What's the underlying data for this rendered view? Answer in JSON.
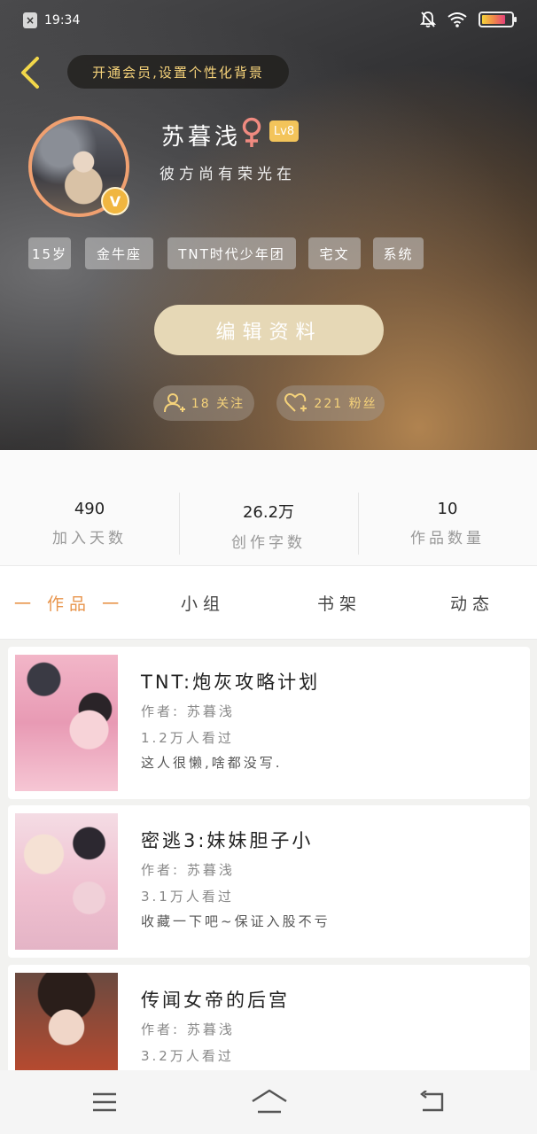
{
  "status_bar": {
    "time": "19:34",
    "battery_level": 0.8
  },
  "header": {
    "vip_prompt": "开通会员,设置个性化背景",
    "username": "苏暮浅",
    "level": "Lv8",
    "signature": "彼方尚有荣光在",
    "verified_badge": "V",
    "tags": [
      "15岁",
      "金牛座",
      "TNT时代少年团",
      "宅文",
      "系统"
    ],
    "edit_profile": "编辑资料",
    "following": "18 关注",
    "followers": "221 粉丝",
    "colors": {
      "accent_gold": "#f5d27a",
      "level_badge": "#f3c45a",
      "avatar_ring": "#f0a070"
    }
  },
  "stats": [
    {
      "value": "490",
      "label": "加入天数"
    },
    {
      "value": "26.2万",
      "label": "创作字数"
    },
    {
      "value": "10",
      "label": "作品数量"
    }
  ],
  "tabs": [
    {
      "label": "作品",
      "active": true
    },
    {
      "label": "小组",
      "active": false
    },
    {
      "label": "书架",
      "active": false
    },
    {
      "label": "动态",
      "active": false
    }
  ],
  "works": [
    {
      "title": "TNT:炮灰攻略计划",
      "author": "作者: 苏暮浅",
      "views": "1.2万人看过",
      "desc": "这人很懒,啥都没写."
    },
    {
      "title": "密逃3:妹妹胆子小",
      "author": "作者: 苏暮浅",
      "views": "3.1万人看过",
      "desc": "收藏一下吧~保证入股不亏"
    },
    {
      "title": "传闻女帝的后宫",
      "author": "作者: 苏暮浅",
      "views": "3.2万人看过",
      "desc": ""
    }
  ],
  "nav": {
    "icons": [
      "menu-icon",
      "home-icon",
      "back-icon"
    ]
  }
}
